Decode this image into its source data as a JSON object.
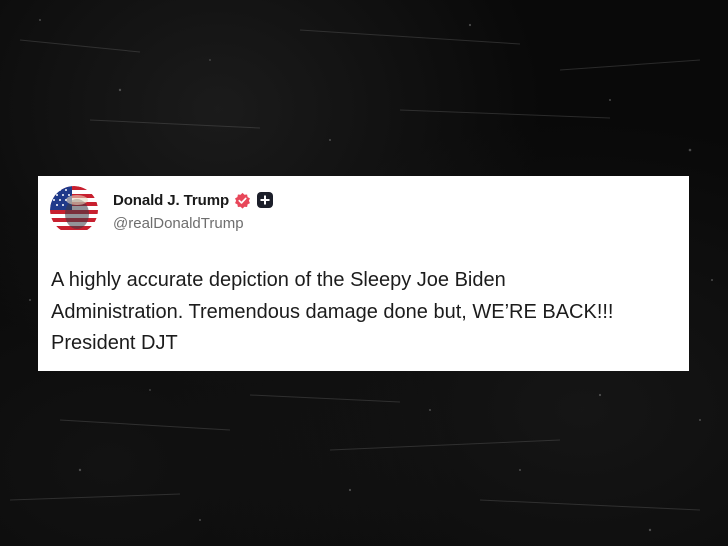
{
  "post": {
    "author_name": "Donald J. Trump",
    "handle": "@realDonaldTrump",
    "body": "A highly accurate depiction of the Sleepy Joe Biden\nAdministration. Tremendous damage done but, WE’RE BACK!!!\nPresident DJT"
  },
  "icons": {
    "avatar": "avatar-flag-portrait",
    "verified": "verified-badge-icon",
    "plus": "plus-badge-icon"
  },
  "colors": {
    "verified_badge": "#e8475a",
    "plus_badge": "#1c1f2a",
    "background": "#0b0b0b",
    "card": "#ffffff"
  }
}
